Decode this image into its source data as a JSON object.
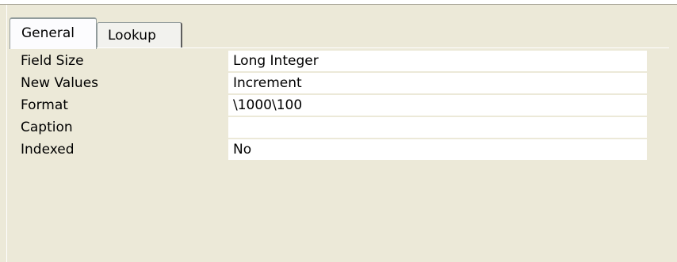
{
  "tabs": [
    {
      "label": "General",
      "active": true
    },
    {
      "label": "Lookup",
      "active": false
    }
  ],
  "properties": [
    {
      "label": "Field Size",
      "value": "Long Integer"
    },
    {
      "label": "New Values",
      "value": "Increment"
    },
    {
      "label": "Format",
      "value": "\\1000\\100"
    },
    {
      "label": "Caption",
      "value": ""
    },
    {
      "label": "Indexed",
      "value": "No"
    }
  ],
  "colors": {
    "window_background": "#ece9d8",
    "field_background": "#ffffff",
    "tab_border": "#919b9c"
  }
}
